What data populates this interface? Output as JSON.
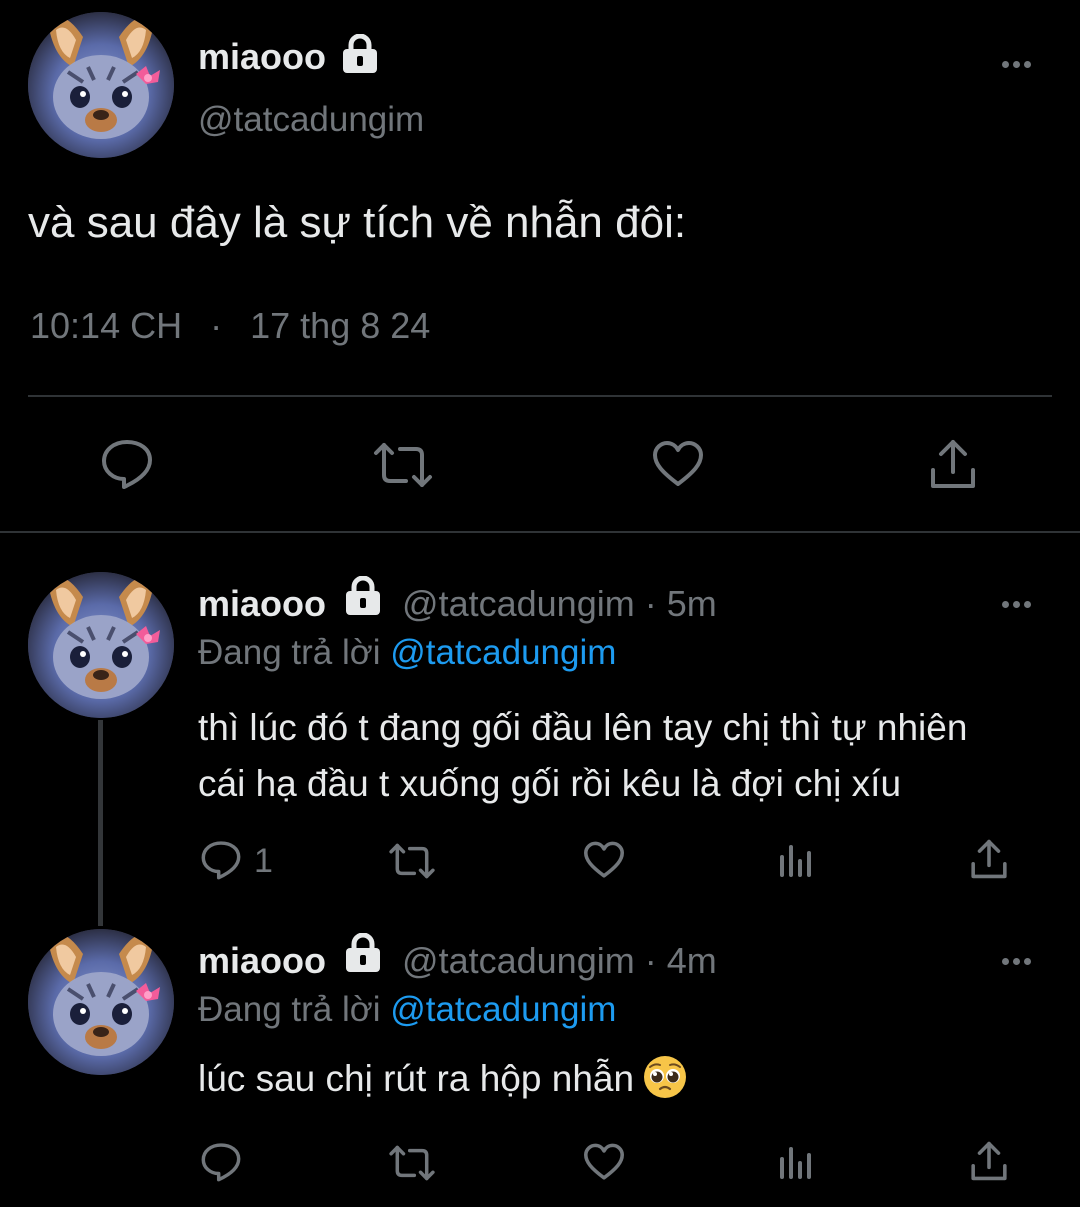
{
  "main_tweet": {
    "display_name": "miaooo",
    "handle": "@tatcadungim",
    "text": "và sau đây là sự tích về nhẫn đôi:",
    "time": "10:14 CH",
    "separator": "·",
    "date": "17 thg 8 24"
  },
  "replies": [
    {
      "display_name": "miaooo",
      "handle": "@tatcadungim",
      "meta": "· 5m",
      "replying_prefix": "Đang trả lời",
      "replying_to": "@tatcadungim",
      "text_line1": "thì lúc đó t đang gối đầu lên tay chị thì tự nhiên",
      "text_line2": "cái hạ đầu t xuống gối rồi kêu là đợi chị xíu",
      "reply_count": "1"
    },
    {
      "display_name": "miaooo",
      "handle": "@tatcadungim",
      "meta": "· 4m",
      "replying_prefix": "Đang trả lời",
      "replying_to": "@tatcadungim",
      "text": "lúc sau chị rút ra hộp nhẫn",
      "emoji": "pleading-face",
      "reply_count": ""
    }
  ],
  "icons": {
    "reply": "reply-icon",
    "retweet": "retweet-icon",
    "like": "heart-icon",
    "views": "views-icon",
    "share": "share-icon",
    "lock": "lock-icon",
    "more": "more-icon"
  },
  "colors": {
    "background": "#000000",
    "text": "#e7e9ea",
    "muted": "#71767b",
    "link": "#1d9bf0",
    "divider": "#2f3336"
  }
}
